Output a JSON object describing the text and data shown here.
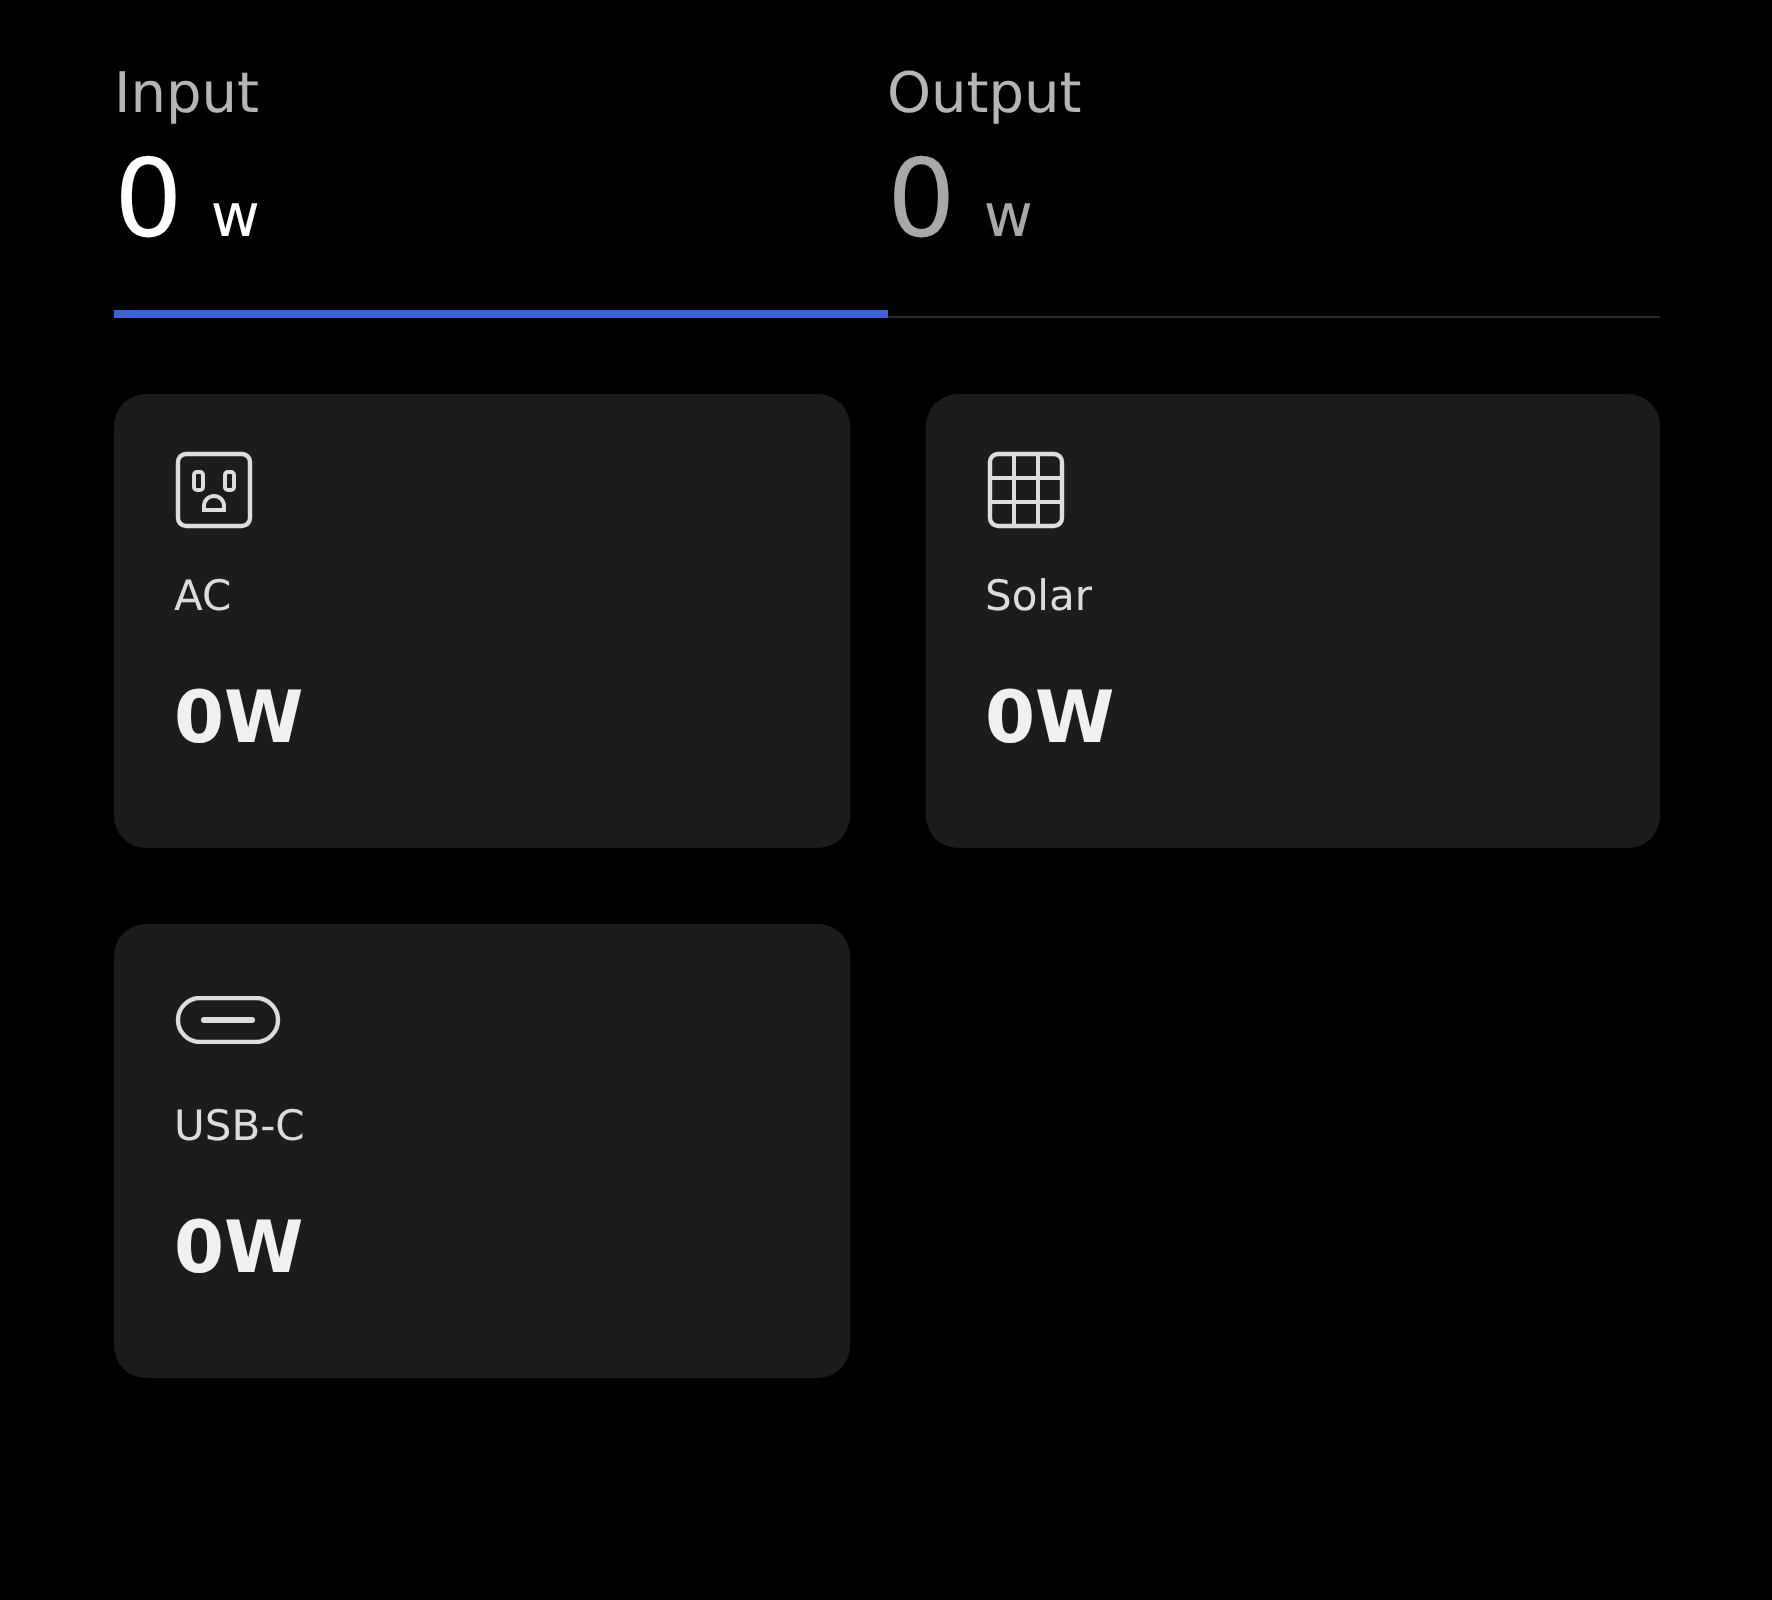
{
  "tabs": [
    {
      "label": "Input",
      "value": "0",
      "unit": "w",
      "selected": true
    },
    {
      "label": "Output",
      "value": "0",
      "unit": "w",
      "selected": false
    }
  ],
  "sources": [
    {
      "kind": "ac",
      "label": "AC",
      "value": "0W"
    },
    {
      "kind": "solar",
      "label": "Solar",
      "value": "0W"
    },
    {
      "kind": "usbc",
      "label": "USB-C",
      "value": "0W"
    }
  ]
}
